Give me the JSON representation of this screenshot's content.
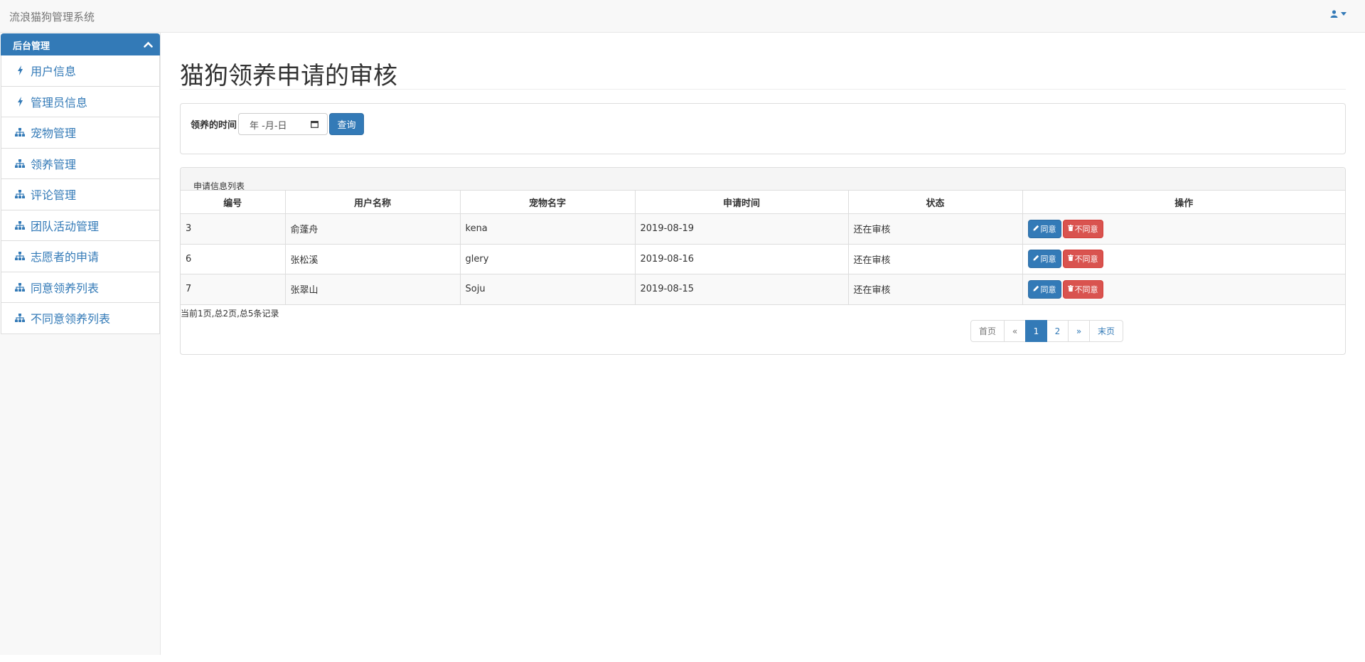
{
  "app": {
    "brand": "流浪猫狗管理系统",
    "accent": "#337ab7",
    "user_icon": "user-icon"
  },
  "sidebar": {
    "header": "后台管理",
    "items": [
      {
        "label": "用户信息",
        "icon": "bolt-icon"
      },
      {
        "label": "管理员信息",
        "icon": "bolt-icon"
      },
      {
        "label": "宠物管理",
        "icon": "sitemap-icon"
      },
      {
        "label": "领养管理",
        "icon": "sitemap-icon"
      },
      {
        "label": "评论管理",
        "icon": "sitemap-icon"
      },
      {
        "label": "团队活动管理",
        "icon": "sitemap-icon"
      },
      {
        "label": "志愿者的申请",
        "icon": "sitemap-icon"
      },
      {
        "label": "同意领养列表",
        "icon": "sitemap-icon"
      },
      {
        "label": "不同意领养列表",
        "icon": "sitemap-icon"
      }
    ]
  },
  "main": {
    "title": "猫狗领养申请的审核",
    "search": {
      "label": "领养的时间",
      "date_placeholder": "年 -月-日",
      "button": "查询"
    },
    "list": {
      "caption": "申请信息列表",
      "columns": [
        "编号",
        "用户名称",
        "宠物名字",
        "申请时间",
        "状态",
        "操作"
      ],
      "rows": [
        {
          "id": "3",
          "user": "俞蓬舟",
          "pet": "kena",
          "date": "2019-08-19",
          "status": "还在审核"
        },
        {
          "id": "6",
          "user": "张松溪",
          "pet": "glery",
          "date": "2019-08-16",
          "status": "还在审核"
        },
        {
          "id": "7",
          "user": "张翠山",
          "pet": "Soju",
          "date": "2019-08-15",
          "status": "还在审核"
        }
      ],
      "agree_label": "同意",
      "disagree_label": "不同意",
      "page_info": "当前1页,总2页,总5条记录",
      "pagination": {
        "first": "首页",
        "prev": "«",
        "pages": [
          "1",
          "2"
        ],
        "current": "1",
        "next": "»",
        "last": "末页"
      }
    }
  }
}
